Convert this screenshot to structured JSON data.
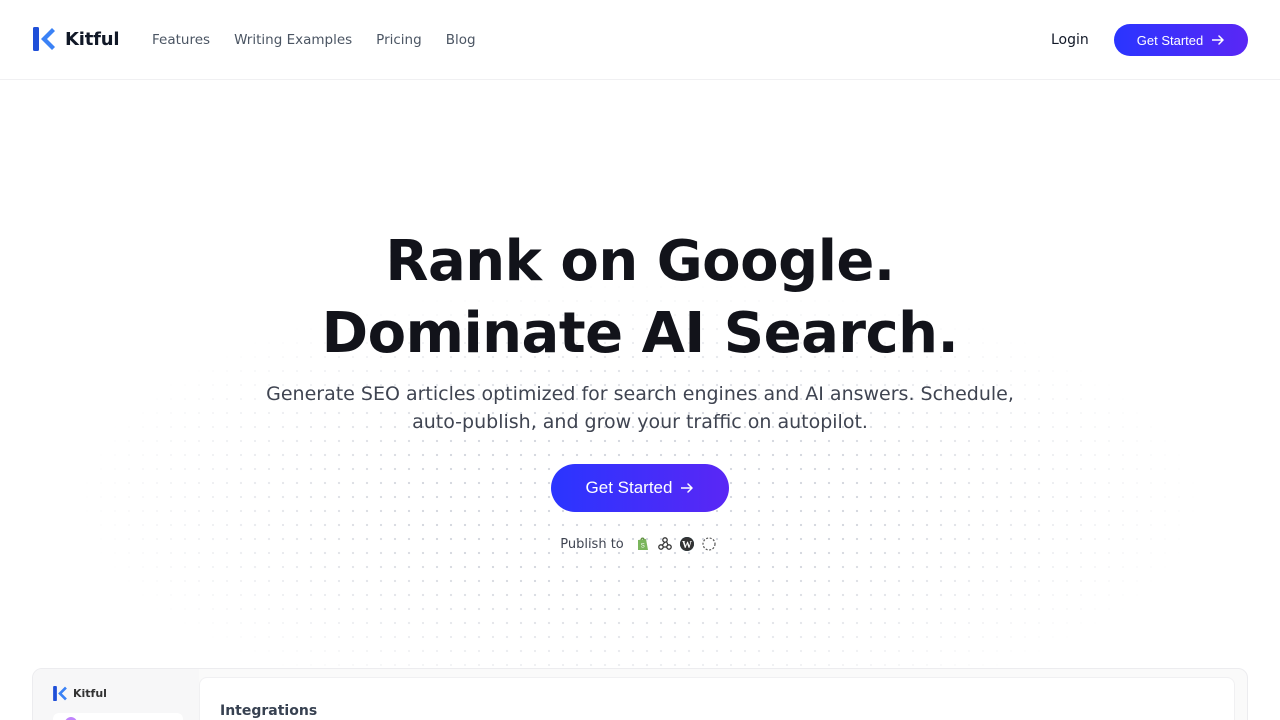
{
  "brand": {
    "name": "Kitful",
    "accent_start": "#2a35ff",
    "accent_end": "#5a27f5",
    "logo_color": "#1f4fd8"
  },
  "nav": {
    "links": [
      "Features",
      "Writing Examples",
      "Pricing",
      "Blog"
    ],
    "login": "Login",
    "cta": "Get Started"
  },
  "hero": {
    "title_line1": "Rank on Google.",
    "title_line2": "Dominate AI Search.",
    "subtitle": "Generate SEO articles optimized for search engines and AI answers. Schedule, auto-publish, and grow your traffic on autopilot.",
    "cta": "Get Started",
    "publish_label": "Publish to",
    "publish_icons": [
      "shopify-icon",
      "webhook-icon",
      "wordpress-icon",
      "loading-circle-icon"
    ]
  },
  "preview": {
    "brand": "Kitful",
    "section_title": "Integrations"
  }
}
